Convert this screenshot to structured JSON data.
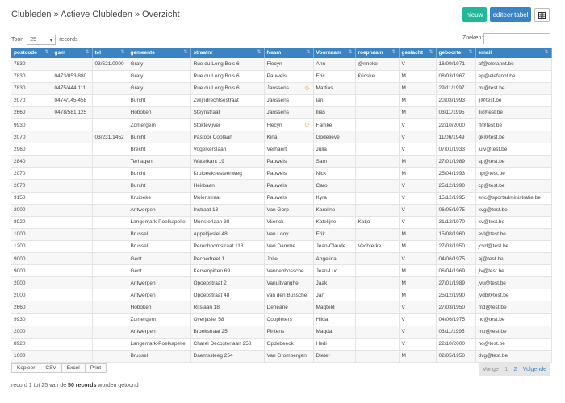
{
  "header": {
    "breadcrumb": "Clubleden » Actieve Clubleden » Overzicht",
    "new_button": "nieuw",
    "edit_table_button": "editeer tabel",
    "grid_icon": "table-icon"
  },
  "controls": {
    "show_label": "Toon",
    "page_size": "25",
    "records_label": "records",
    "search_label": "Zoeken:",
    "search_value": ""
  },
  "columns": [
    "postcode",
    "gsm",
    "tel",
    "gemeente",
    "straatnr",
    "Naam",
    "Voornaam",
    "roepnaam",
    "geslacht",
    "geboorte",
    "email"
  ],
  "rows": [
    [
      "7830",
      "",
      "03/521.0000",
      "Graty",
      "Rue du Long Bois 6",
      "Flecyn",
      "Ann",
      "@nneke",
      "V",
      "16/09/1971",
      "af@elefannt.be"
    ],
    [
      "7830",
      "0473/853.880",
      "",
      "Graty",
      "Rue du Long Bois 6",
      "Pauwels",
      "Eric",
      "€ricske",
      "M",
      "08/03/1967",
      "ep@elefannt.be"
    ],
    [
      "7830",
      "0475/444.111",
      "",
      "Graty",
      "Rue du Long Bois 6",
      "Janssens",
      "Mattias",
      "",
      "M",
      "29/11/1997",
      "mj@test.be"
    ],
    [
      "2070",
      "0474/145.458",
      "",
      "Burcht",
      "Zwijndrechtsestraat",
      "Janssens",
      "Ian",
      "",
      "M",
      "20/03/1993",
      "ij@test.be"
    ],
    [
      "2660",
      "0478/581.125",
      "",
      "Hoboken",
      "Steynstraat",
      "Janssens",
      "Ilias",
      "",
      "M",
      "03/11/1995",
      "ili@test.be"
    ],
    [
      "9930",
      "",
      "",
      "Zomergem",
      "Stoktevijver",
      "Flecyn",
      "Famke",
      "",
      "V",
      "22/10/2000",
      "ff@test.be"
    ],
    [
      "2070",
      "",
      "03/231.1452",
      "Burcht",
      "Pastoor Coplaan",
      "Kina",
      "Godelieve",
      "",
      "V",
      "11/06/1949",
      "gk@test.be"
    ],
    [
      "2960",
      "",
      "",
      "Brecht",
      "Vogelkerslaan",
      "Verhaert",
      "Julia",
      "",
      "V",
      "07/01/1933",
      "julv@test.be"
    ],
    [
      "2840",
      "",
      "",
      "Terhagen",
      "Waterkant 19",
      "Pauwels",
      "Sam",
      "",
      "M",
      "27/01/1989",
      "sp@test.be"
    ],
    [
      "2070",
      "",
      "",
      "Burcht",
      "Kruibeeksesteenweg",
      "Pauwels",
      "Nick",
      "",
      "M",
      "25/04/1993",
      "np@test.be"
    ],
    [
      "2070",
      "",
      "",
      "Burcht",
      "Heirbaan",
      "Pauwels",
      "Caro",
      "",
      "V",
      "25/12/1990",
      "cp@test.be"
    ],
    [
      "9150",
      "",
      "",
      "Kruibeke",
      "Molenstraat",
      "Pauwels",
      "Kyra",
      "",
      "V",
      "15/12/1995",
      "eric@sportadministratie.be"
    ],
    [
      "2000",
      "",
      "",
      "Antwerpen",
      "Instraat 13",
      "Van Gorp",
      "Karoline",
      "",
      "V",
      "06/05/1975",
      "kvg@test.be"
    ],
    [
      "8920",
      "",
      "",
      "Langemark-Poelkapelle",
      "Monsterlaan 38",
      "Vlierick",
      "Katelijne",
      "Katje",
      "V",
      "31/12/1970",
      "kv@test.be"
    ],
    [
      "1000",
      "",
      "",
      "Brussel",
      "Appeltjeslei 48",
      "Van Looy",
      "Erik",
      "",
      "M",
      "15/08/1960",
      "evl@test.be"
    ],
    [
      "1200",
      "",
      "",
      "Brussel",
      "Perenboomstraat 118",
      "Van Damme",
      "Jean-Claude",
      "Vechterke",
      "M",
      "27/03/1950",
      "jcvd@test.be"
    ],
    [
      "9000",
      "",
      "",
      "Gent",
      "Pechedreef 1",
      "Jolie",
      "Angelina",
      "",
      "V",
      "04/06/1975",
      "aj@test.be"
    ],
    [
      "9000",
      "",
      "",
      "Gent",
      "Kersenpitten 69",
      "Vandenbossche",
      "Jean-Luc",
      "",
      "M",
      "06/04/1969",
      "jlv@test.be"
    ],
    [
      "2000",
      "",
      "",
      "Antwerpen",
      "Opoepstraat 2",
      "Vanuitvanghe",
      "Jaak",
      "",
      "M",
      "27/01/1989",
      "jvu@test.be"
    ],
    [
      "2000",
      "",
      "",
      "Antwerpen",
      "Opoepstraat 48",
      "van den Bussche",
      "Jan",
      "",
      "M",
      "25/12/1990",
      "jvdb@test.be"
    ],
    [
      "2660",
      "",
      "",
      "Hoboken",
      "Ritslaan 18",
      "Deheane",
      "Magteld",
      "",
      "V",
      "27/03/1950",
      "md@test.be"
    ],
    [
      "9930",
      "",
      "",
      "Zomergem",
      "Overjaslei 58",
      "Coppieters",
      "Hilda",
      "",
      "V",
      "04/06/1975",
      "hc@test.be"
    ],
    [
      "2000",
      "",
      "",
      "Antwerpen",
      "Broekstraat 25",
      "Pintens",
      "Magda",
      "",
      "V",
      "03/11/1995",
      "mp@test.be"
    ],
    [
      "8920",
      "",
      "",
      "Langemark-Poelkapelle",
      "Charel Decosterlaan 258",
      "Opdebeeck",
      "Hedi",
      "",
      "V",
      "22/10/2000",
      "ho@test.be"
    ],
    [
      "1000",
      "",
      "",
      "Brussel",
      "Daemssteeg 254",
      "Van Grombergen",
      "Dieter",
      "",
      "M",
      "02/05/1950",
      "dvg@test.be"
    ]
  ],
  "warn_rows": [
    2,
    5
  ],
  "warn_icon": "refresh-icon",
  "export": [
    "Kopieer",
    "CSV",
    "Excel",
    "Print"
  ],
  "pager": {
    "prev": "Vorige",
    "page1": "1",
    "page2": "2",
    "next": "Volgende"
  },
  "info": {
    "prefix": "record 1 tot 25 van de ",
    "count": "50 records",
    "suffix": " worden getoond"
  }
}
